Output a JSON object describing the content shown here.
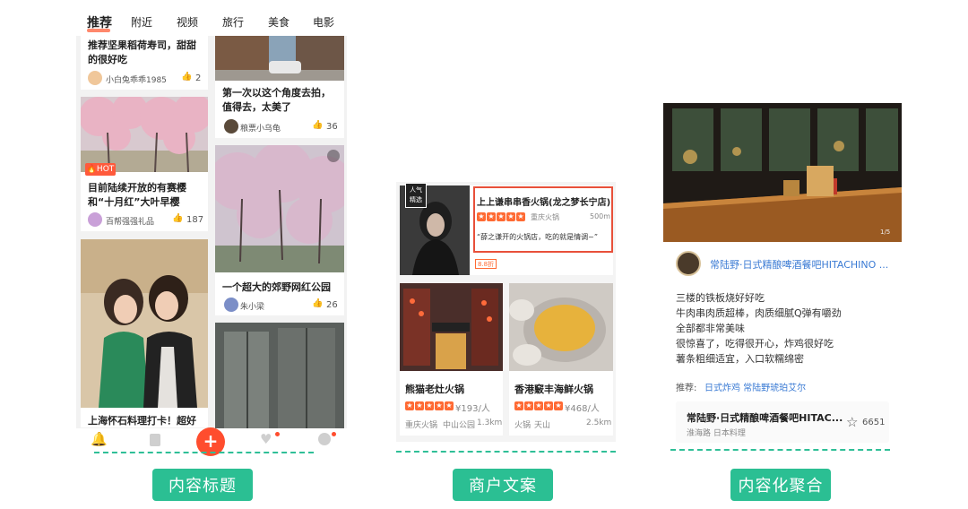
{
  "colors": {
    "accent": "#ff4d2e",
    "green": "#2bbf93",
    "dash": "#2fbf97"
  },
  "tabs": [
    "推荐",
    "附近",
    "视频",
    "旅行",
    "美食",
    "电影"
  ],
  "feed": {
    "left": [
      {
        "title": "推荐坚果稻荷寿司，甜甜的很好吃",
        "author": "小白兔乖乖1985",
        "likes": "2"
      },
      {
        "badge": "HOT",
        "title": "目前陆续开放的有赛樱和“十月红”大叶早樱",
        "author": "百帮强强礼品",
        "likes": "187"
      },
      {
        "title": "上海怀石料理打卡！超好"
      }
    ],
    "right": [
      {
        "title": "第一次以这个角度去拍，值得去，太美了",
        "author": "粮票小乌龟",
        "likes": "36"
      },
      {
        "title": "一个超大的郊野网红公园",
        "author": "朱小梁",
        "likes": "26"
      }
    ]
  },
  "bottom_nav": {
    "icons": [
      "bell-icon",
      "bookmark-icon",
      "plus-icon",
      "heart-icon",
      "profile-icon"
    ],
    "plus": "+"
  },
  "merchant": {
    "featured": {
      "tag_line1": "人气",
      "tag_line2": "精选",
      "name": "上上谦串串香火锅(龙之梦长宁店)",
      "category": "重庆火锅",
      "distance": "500m",
      "quote": "“薛之谦开的火锅店，吃的就是情调~”",
      "discount": "8.8折"
    },
    "cards": [
      {
        "name": "熊猫老灶火锅",
        "price": "¥193/人",
        "category": "重庆火锅",
        "area": "中山公园",
        "distance": "1.3km"
      },
      {
        "name": "香港竅丰海鲜火锅",
        "price": "¥468/人",
        "category": "火锅",
        "area": "天山",
        "distance": "2.5km"
      }
    ]
  },
  "aggregate": {
    "photo_counter": "1/5",
    "header_name": "常陆野·日式精酿啤酒餐吧HITACHINO ...",
    "lines": [
      "三楼的铁板烧好好吃",
      "牛肉串肉质超棒，肉质细腻Q弹有嚼劲",
      "全部都非常美味",
      "很惊喜了，吃得很开心，炸鸡很好吃",
      "薯条粗细适宜，入口软糯绵密"
    ],
    "recommend_label": "推荐:",
    "recommend_items": "日式炸鸡 常陆野琥珀艾尔",
    "shop_name": "常陆野·日式精酿啤酒餐吧HITAC...",
    "shop_area": "淮海路 日本料理",
    "favorites": "6651"
  },
  "labels": [
    "内容标题",
    "商户文案",
    "内容化聚合"
  ]
}
